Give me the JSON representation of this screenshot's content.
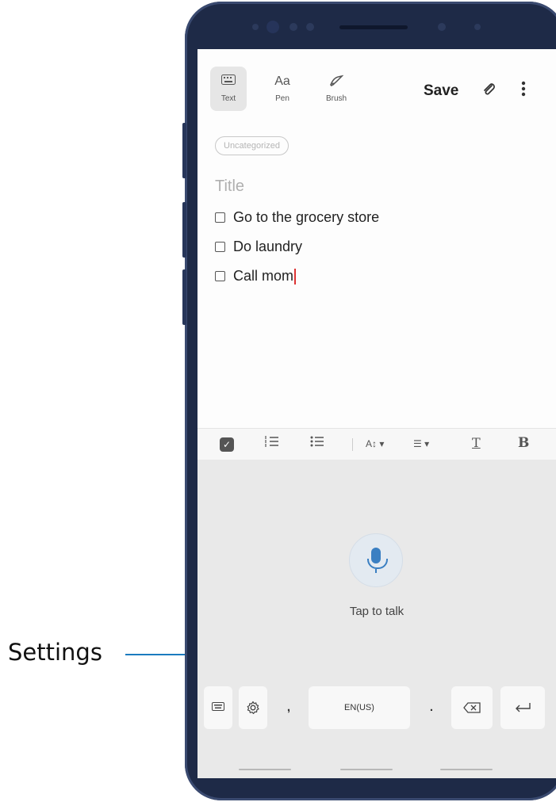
{
  "callout": {
    "label": "Settings"
  },
  "toolbar": {
    "tools": [
      {
        "label": "Text",
        "icon": "keyboard-icon"
      },
      {
        "label": "Pen",
        "icon": "pen-text-icon"
      },
      {
        "label": "Brush",
        "icon": "brush-icon"
      }
    ],
    "save_label": "Save",
    "attach_icon": "paperclip-icon",
    "more_icon": "more-vertical-icon"
  },
  "note": {
    "category": "Uncategorized",
    "title_placeholder": "Title",
    "checklist": [
      {
        "text": "Go to the grocery store",
        "checked": false
      },
      {
        "text": "Do laundry",
        "checked": false
      },
      {
        "text": "Call mom",
        "checked": false
      }
    ]
  },
  "format_bar": {
    "icons": [
      "checkbox-list-icon",
      "numbered-list-icon",
      "bullet-list-icon",
      "font-size-icon",
      "align-icon",
      "text-color-icon",
      "bold-icon"
    ],
    "bold_label": "B",
    "text_color_label": "T"
  },
  "keyboard": {
    "voice_prompt": "Tap to talk",
    "keys": {
      "keyboard_toggle_icon": "keyboard-icon",
      "settings_icon": "gear-icon",
      "comma": ",",
      "space_label": "EN(US)",
      "period": ".",
      "backspace_icon": "backspace-icon",
      "enter_icon": "enter-icon"
    }
  },
  "colors": {
    "callout_line": "#1b7bbf",
    "phone_body": "#1e2a47",
    "mic_accent": "#3a7fc2",
    "caret": "#dd3333"
  }
}
